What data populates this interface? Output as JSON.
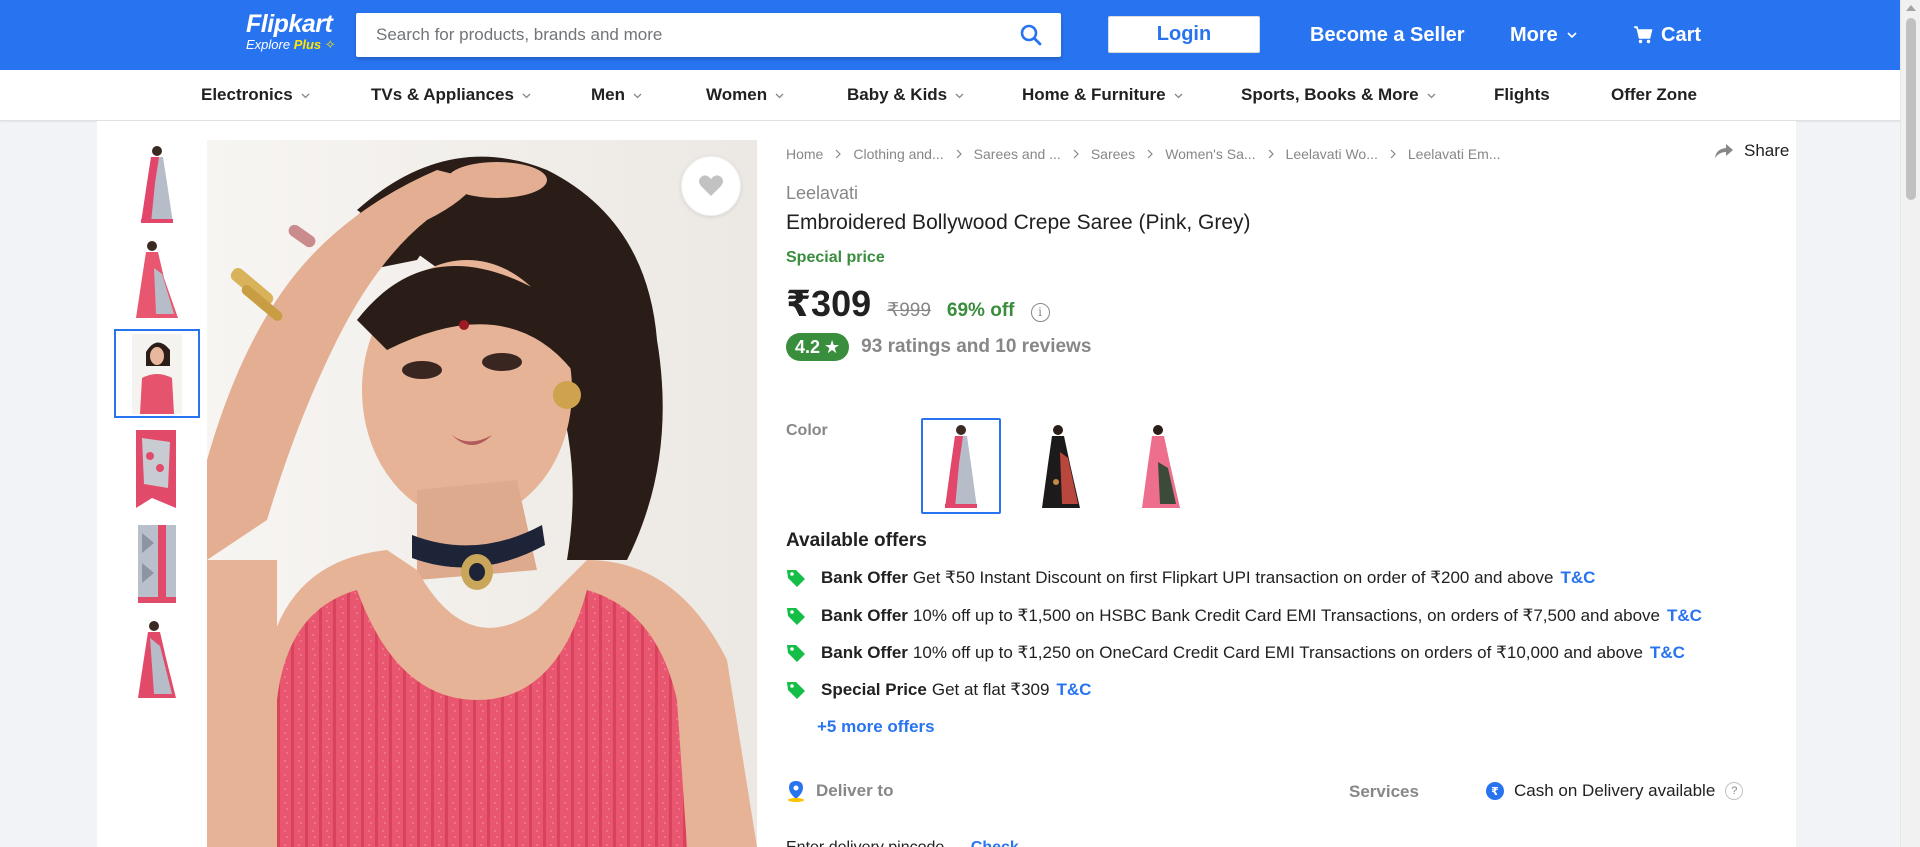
{
  "header": {
    "logo_text": "Flipkart",
    "logo_sub": "Explore",
    "logo_plus": "Plus",
    "search_placeholder": "Search for products, brands and more",
    "login_label": "Login",
    "become_seller": "Become a Seller",
    "more_label": "More",
    "cart_label": "Cart"
  },
  "categories": [
    {
      "label": "Electronics",
      "has_menu": true
    },
    {
      "label": "TVs & Appliances",
      "has_menu": true
    },
    {
      "label": "Men",
      "has_menu": true
    },
    {
      "label": "Women",
      "has_menu": true
    },
    {
      "label": "Baby & Kids",
      "has_menu": true
    },
    {
      "label": "Home & Furniture",
      "has_menu": true
    },
    {
      "label": "Sports, Books & More",
      "has_menu": true
    },
    {
      "label": "Flights",
      "has_menu": false
    },
    {
      "label": "Offer Zone",
      "has_menu": false
    }
  ],
  "gallery": {
    "thumbnails": [
      "thumb-1",
      "thumb-2",
      "thumb-3",
      "thumb-4",
      "thumb-5",
      "thumb-6"
    ],
    "active_index": 2
  },
  "breadcrumb": [
    "Home",
    "Clothing and...",
    "Sarees and ...",
    "Sarees",
    "Women's Sa...",
    "Leelavati Wo...",
    "Leelavati Em..."
  ],
  "share_label": "Share",
  "product": {
    "brand": "Leelavati",
    "title": "Embroidered Bollywood Crepe Saree  (Pink, Grey)",
    "special_label": "Special price",
    "price": "₹309",
    "mrp": "₹999",
    "discount": "69% off",
    "info_icon": "i",
    "rating": "4.2",
    "rating_star": "★",
    "ratings_text": "93 ratings and 10 reviews"
  },
  "color": {
    "label": "Color",
    "swatches": [
      "pink-grey",
      "black",
      "pink"
    ],
    "selected": 0
  },
  "offers": {
    "title": "Available offers",
    "items": [
      {
        "type": "Bank Offer",
        "text": "Get ₹50 Instant Discount on first Flipkart UPI transaction on order of ₹200 and above",
        "tnc": "T&C"
      },
      {
        "type": "Bank Offer",
        "text": "10% off up to ₹1,500 on HSBC Bank Credit Card EMI Transactions, on orders of ₹7,500 and above",
        "tnc": "T&C"
      },
      {
        "type": "Bank Offer",
        "text": "10% off up to ₹1,250 on OneCard Credit Card EMI Transactions on orders of ₹10,000 and above",
        "tnc": "T&C"
      },
      {
        "type": "Special Price",
        "text": "Get at flat ₹309",
        "tnc": "T&C"
      }
    ],
    "more": "+5 more offers"
  },
  "delivery": {
    "deliver_to": "Deliver to",
    "services_label": "Services",
    "cod_icon": "₹",
    "cod_text": "Cash on Delivery available",
    "help_icon": "?",
    "pincode_hint": "Enter delivery pincode",
    "check_label": "Check"
  },
  "colors": {
    "brand_blue": "#2874f0",
    "offer_green": "#388e3c",
    "tag_green": "#14be47",
    "muted": "#878787"
  }
}
